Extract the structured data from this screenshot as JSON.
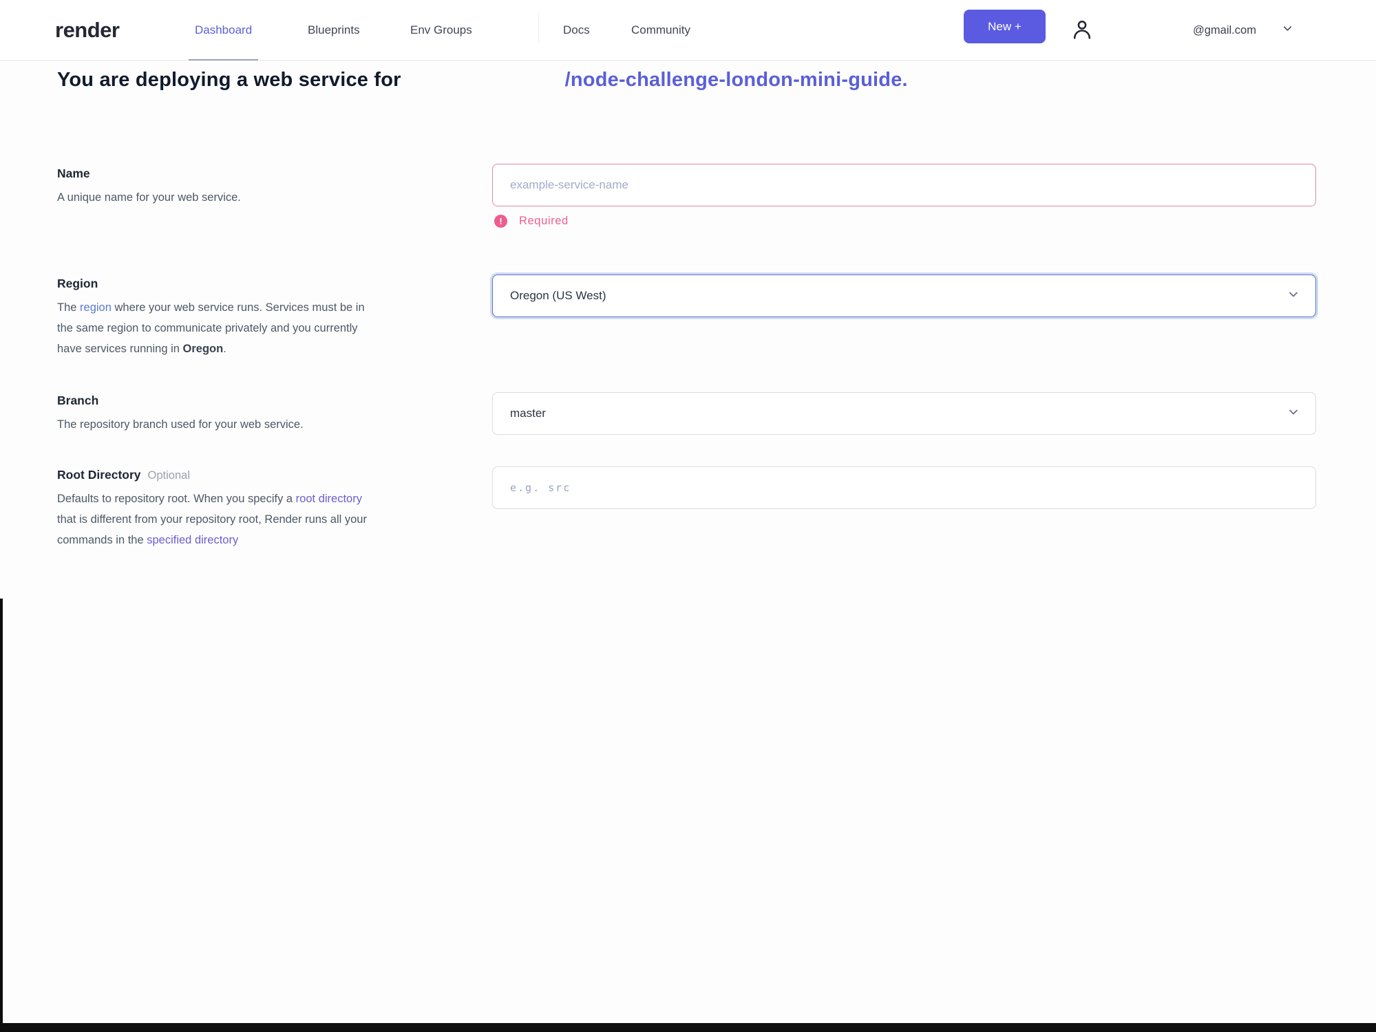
{
  "nav": {
    "logo": "render",
    "items": [
      {
        "label": "Dashboard",
        "active": true
      },
      {
        "label": "Blueprints",
        "active": false
      },
      {
        "label": "Env Groups",
        "active": false
      },
      {
        "label": "Docs",
        "active": false
      },
      {
        "label": "Community",
        "active": false
      }
    ],
    "new_button_label": "New +",
    "account_email": "@gmail.com"
  },
  "heading": {
    "prefix": "You are deploying a web service for",
    "repo_link": "/node-challenge-london-mini-guide."
  },
  "form": {
    "name": {
      "label": "Name",
      "description": "A unique name for your web service.",
      "placeholder": "example-service-name",
      "value": "",
      "error": "Required",
      "error_icon": "!"
    },
    "region": {
      "label": "Region",
      "desc_parts": [
        "The ",
        "region",
        " where your web service runs. Services must be in the same region to communicate privately and you currently have services running in ",
        "Oregon",
        "."
      ],
      "value": "Oregon (US West)"
    },
    "branch": {
      "label": "Branch",
      "description": "The repository branch used for your web service.",
      "value": "master"
    },
    "root_directory": {
      "label": "Root Directory",
      "optional_tag": "Optional",
      "desc_parts": [
        "Defaults to repository root. When you specify a ",
        "root directory",
        " that is different from your repository root, Render runs all your commands in the ",
        "specified directory",
        ""
      ],
      "placeholder": "e.g. src",
      "value": ""
    }
  },
  "colors": {
    "accent_purple": "#5b5be1",
    "active_tab_purple": "#5a62d8",
    "repo_link_purple": "#5a5fd8",
    "link_blue": "#5f7ac9",
    "link_purple": "#6a5fd0",
    "error_pink": "#ee5d8d"
  }
}
